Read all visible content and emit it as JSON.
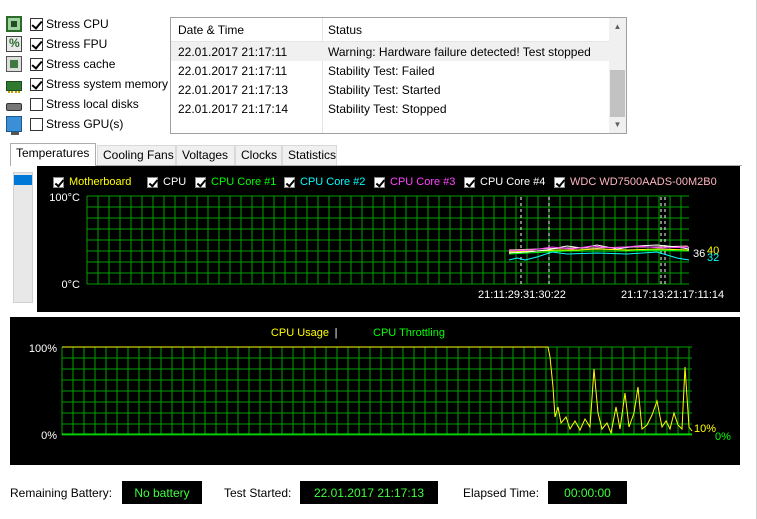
{
  "stress_options": [
    {
      "label": "Stress CPU",
      "checked": true,
      "icon": "cpu-icon"
    },
    {
      "label": "Stress FPU",
      "checked": true,
      "icon": "fpu-icon"
    },
    {
      "label": "Stress cache",
      "checked": true,
      "icon": "cache-icon"
    },
    {
      "label": "Stress system memory",
      "checked": true,
      "icon": "memory-icon"
    },
    {
      "label": "Stress local disks",
      "checked": false,
      "icon": "disk-icon"
    },
    {
      "label": "Stress GPU(s)",
      "checked": false,
      "icon": "gpu-icon"
    }
  ],
  "log": {
    "columns": [
      "Date & Time",
      "Status"
    ],
    "rows": [
      {
        "datetime": "22.01.2017 21:17:11",
        "status": "Warning: Hardware failure detected! Test stopped"
      },
      {
        "datetime": "22.01.2017 21:17:11",
        "status": "Stability Test: Failed"
      },
      {
        "datetime": "22.01.2017 21:17:13",
        "status": "Stability Test: Started"
      },
      {
        "datetime": "22.01.2017 21:17:14",
        "status": "Stability Test: Stopped"
      }
    ]
  },
  "tabs": [
    "Temperatures",
    "Cooling Fans",
    "Voltages",
    "Clocks",
    "Statistics"
  ],
  "active_tab": "Temperatures",
  "temperature_graph": {
    "legend": [
      {
        "label": "Motherboard",
        "color": "#ffff00"
      },
      {
        "label": "CPU",
        "color": "#ffffff"
      },
      {
        "label": "CPU Core #1",
        "color": "#00ff00"
      },
      {
        "label": "CPU Core #2",
        "color": "#00ffff"
      },
      {
        "label": "CPU Core #3",
        "color": "#ff44ff"
      },
      {
        "label": "CPU Core #4",
        "color": "#ffffff"
      },
      {
        "label": "WDC WD7500AADS-00M2B0",
        "color": "#ffb6c1"
      }
    ],
    "y_top": "100°C",
    "y_bottom": "0°C",
    "x_labels": [
      "21:11:29:31:30:22",
      "21:17:13:21:17:11:14"
    ],
    "end_values": [
      {
        "text": "36",
        "color": "#ffffff"
      },
      {
        "text": "40",
        "color": "#ffff00"
      },
      {
        "text": "32",
        "color": "#00ffff"
      }
    ]
  },
  "usage_graph": {
    "title_left": "CPU Usage",
    "title_sep": "|",
    "title_right": "CPU Throttling",
    "title_left_color": "#ffff00",
    "title_right_color": "#00ff00",
    "y_top": "100%",
    "y_bottom": "0%",
    "end_values": [
      {
        "text": "10%",
        "color": "#ffff00"
      },
      {
        "text": "0%",
        "color": "#00ff00"
      }
    ]
  },
  "status_bar": {
    "battery_label": "Remaining Battery:",
    "battery_value": "No battery",
    "started_label": "Test Started:",
    "started_value": "22.01.2017 21:17:13",
    "elapsed_label": "Elapsed Time:",
    "elapsed_value": "00:00:00"
  }
}
